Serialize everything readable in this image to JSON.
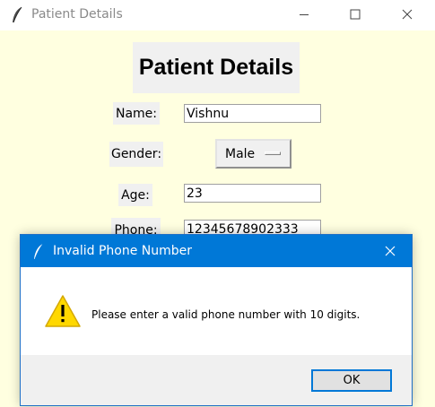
{
  "main_window": {
    "title": "Patient Details",
    "heading": "Patient Details",
    "fields": {
      "name": {
        "label": "Name:",
        "value": "Vishnu"
      },
      "gender": {
        "label": "Gender:",
        "value": "Male"
      },
      "age": {
        "label": "Age:",
        "value": "23"
      },
      "phone": {
        "label": "Phone:",
        "value": "12345678902333"
      }
    },
    "background_color": "#ffffe0",
    "icons": [
      "feather-icon",
      "minimize-icon",
      "maximize-icon",
      "close-icon"
    ]
  },
  "dialog": {
    "title": "Invalid Phone Number",
    "message": "Please enter a valid phone number with 10 digits.",
    "ok_label": "OK",
    "titlebar_color": "#0078d7",
    "icons": [
      "feather-icon",
      "close-icon",
      "warning-icon"
    ]
  }
}
